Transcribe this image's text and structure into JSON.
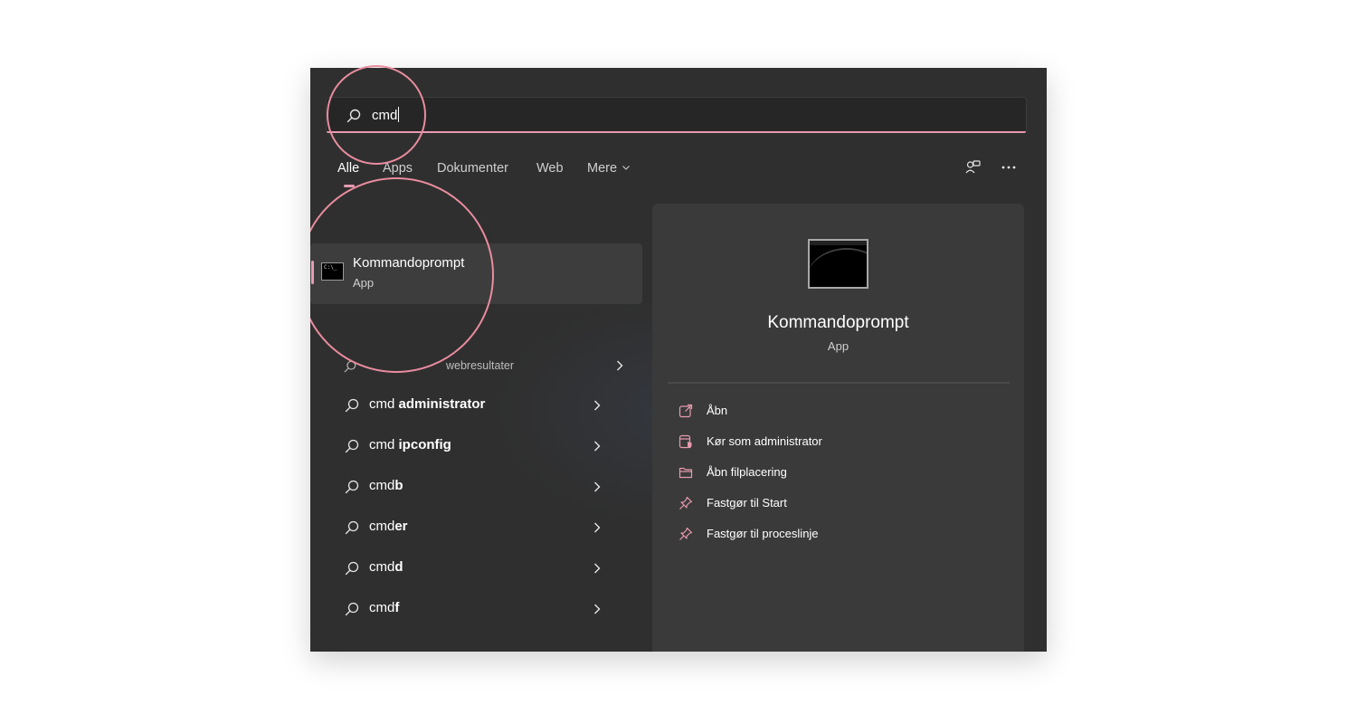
{
  "search": {
    "query": "cmd",
    "icon": "search-icon"
  },
  "tabs": [
    {
      "label": "Alle",
      "active": true
    },
    {
      "label": "Apps",
      "active": false
    },
    {
      "label": "Dokumenter",
      "active": false
    },
    {
      "label": "Web",
      "active": false
    },
    {
      "label": "Mere",
      "active": false
    }
  ],
  "best_match": {
    "title": "Kommandoprompt",
    "subtitle": "App",
    "icon": "command-prompt-icon",
    "icon_text": "C:\\_"
  },
  "web_section": {
    "header": "webresultater"
  },
  "suggestions": [
    {
      "prefix": "cmd ",
      "bold": "administrator"
    },
    {
      "prefix": "cmd ",
      "bold": "ipconfig"
    },
    {
      "prefix": "cmd",
      "bold": "b"
    },
    {
      "prefix": "cmd",
      "bold": "er"
    },
    {
      "prefix": "cmd",
      "bold": "d"
    },
    {
      "prefix": "cmd",
      "bold": "f"
    }
  ],
  "preview": {
    "title": "Kommandoprompt",
    "subtitle": "App",
    "actions": [
      {
        "label": "Åbn",
        "icon": "open-external-icon"
      },
      {
        "label": "Kør som administrator",
        "icon": "run-as-admin-icon"
      },
      {
        "label": "Åbn filplacering",
        "icon": "folder-icon"
      },
      {
        "label": "Fastgør til Start",
        "icon": "pin-icon"
      },
      {
        "label": "Fastgør til proceslinje",
        "icon": "pin-icon"
      }
    ]
  },
  "colors": {
    "accent": "#e79ab0",
    "highlight_ring": "#e98c9f",
    "panel_bg": "#2f2f2f",
    "preview_bg": "#3a3a3a"
  }
}
